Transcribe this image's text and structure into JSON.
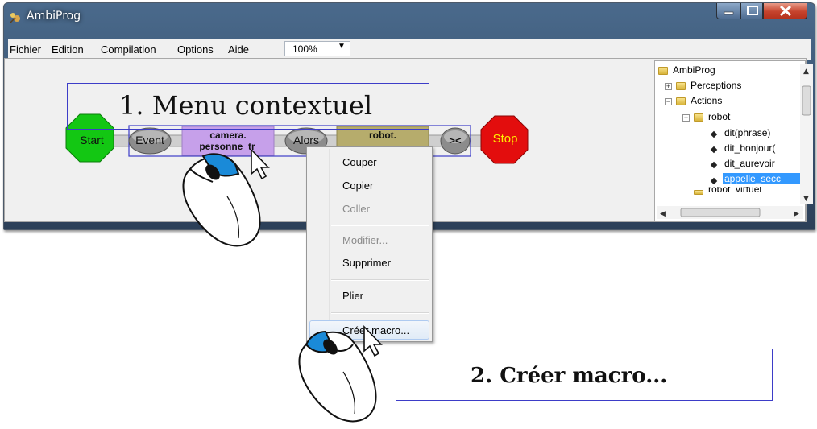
{
  "window": {
    "title": "AmbiProg"
  },
  "menu": [
    "Fichier",
    "Edition",
    "Compilation",
    "Options",
    "Aide"
  ],
  "zoom": {
    "value": "100%"
  },
  "program": {
    "start": "Start",
    "event": "Event",
    "camera_line1": "camera.",
    "camera_line2": "personne_tr",
    "alors": "Alors",
    "robot_line1": "robot.",
    "loop": "><",
    "stop": "Stop"
  },
  "tree": {
    "root": "AmbiProg",
    "perceptions": "Perceptions",
    "actions": "Actions",
    "robot": "robot",
    "methods": [
      "dit(phrase)",
      "dit_bonjour(",
      "dit_aurevoir",
      "appelle_secc"
    ],
    "next": "robot_virtuel"
  },
  "context_menu": {
    "cut": "Couper",
    "copy": "Copier",
    "paste": "Coller",
    "modify": "Modifier...",
    "delete": "Supprimer",
    "fold": "Plier",
    "create_macro": "Créer macro..."
  },
  "callouts": {
    "step1": "1. Menu contextuel",
    "step2": "2. Créer macro..."
  },
  "colors": {
    "start": "#13c713",
    "stop": "#e30d0d",
    "action_block": "#c6a0ea",
    "robot_block": "#b6ac6c",
    "selection": "#3399ff",
    "mouse_button": "#1a8ad8"
  }
}
